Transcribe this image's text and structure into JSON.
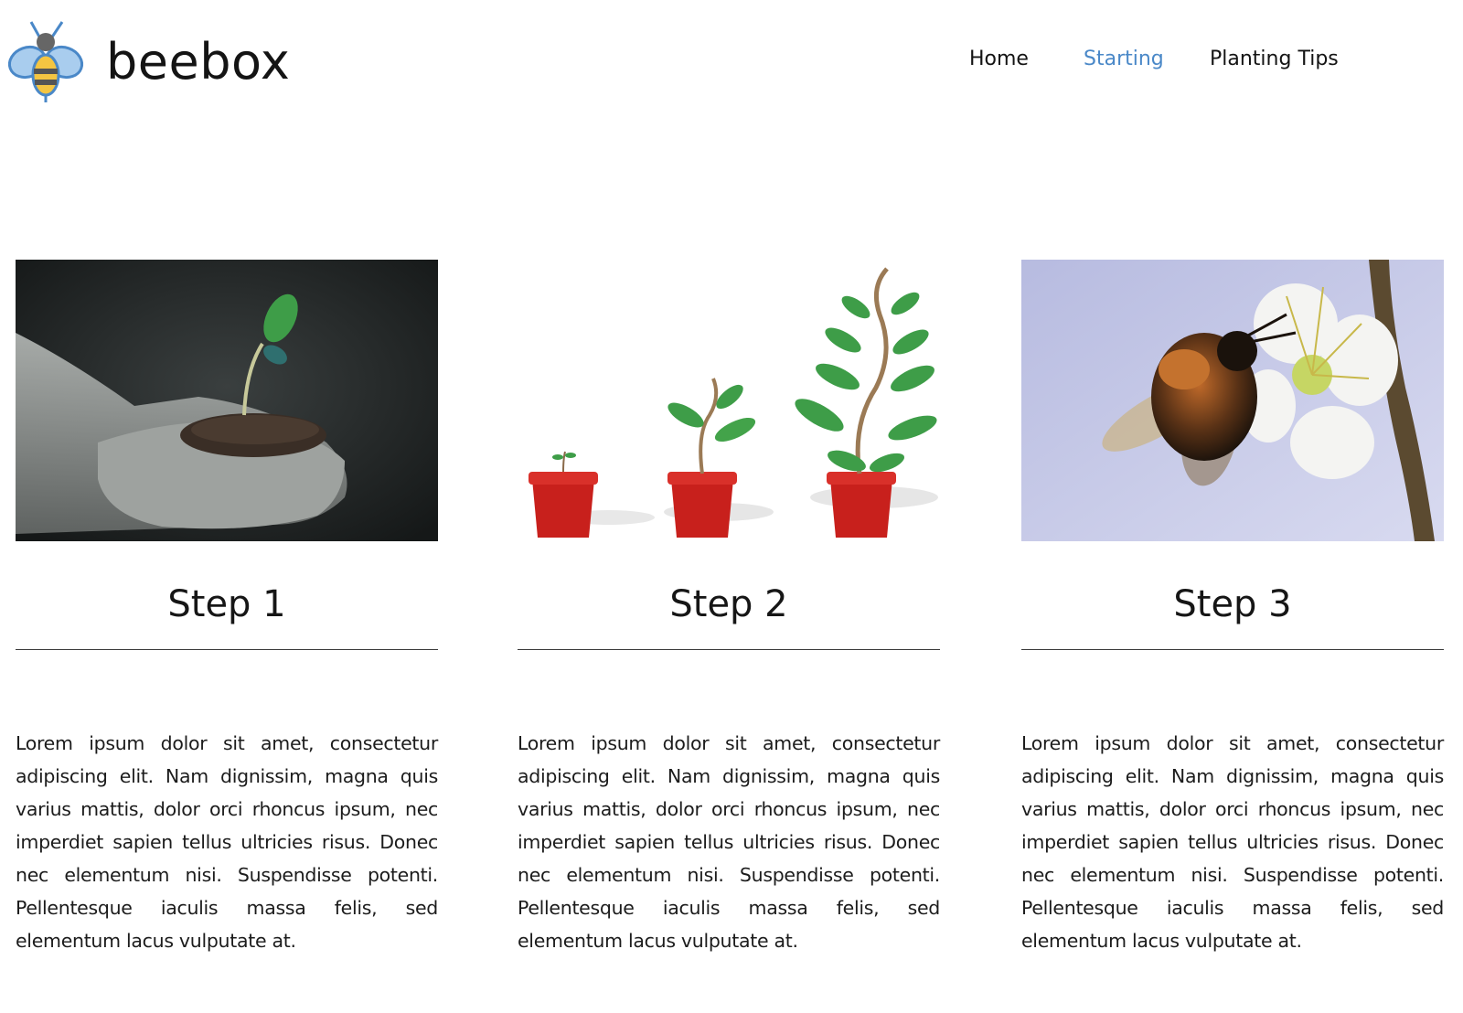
{
  "brand": {
    "name": "beebox",
    "logo_icon": "bee-icon"
  },
  "nav": {
    "items": [
      {
        "label": "Home",
        "active": false
      },
      {
        "label": "Starting",
        "active": true
      },
      {
        "label": "Planting Tips",
        "active": false
      }
    ],
    "active_color": "#4a88c8"
  },
  "steps": [
    {
      "title": "Step 1",
      "image": "hands-holding-seedling-photo",
      "text": "Lorem ipsum dolor sit amet, consectetur adipiscing elit. Nam dignissim, magna quis varius mattis, dolor orci rhoncus ipsum, nec imperdiet sapien tellus ultricies risus. Donec nec elementum nisi. Suspendisse potenti. Pellentesque iaculis massa felis, sed elementum lacus vulputate at."
    },
    {
      "title": "Step 2",
      "image": "growing-plants-in-pots-illustration",
      "text": "Lorem ipsum dolor sit amet, consectetur adipiscing elit. Nam dignissim, magna quis varius mattis, dolor orci rhoncus ipsum, nec imperdiet sapien tellus ultricies risus. Donec nec elementum nisi. Suspendisse potenti. Pellentesque iaculis massa felis, sed elementum lacus vulputate at."
    },
    {
      "title": "Step 3",
      "image": "bee-on-flower-photo",
      "text": "Lorem ipsum dolor sit amet, consectetur adipiscing elit. Nam dignissim, magna quis varius mattis, dolor orci rhoncus ipsum, nec imperdiet sapien tellus ultricies risus. Donec nec elementum nisi. Suspendisse potenti. Pellentesque iaculis massa felis, sed elementum lacus vulputate at."
    }
  ]
}
